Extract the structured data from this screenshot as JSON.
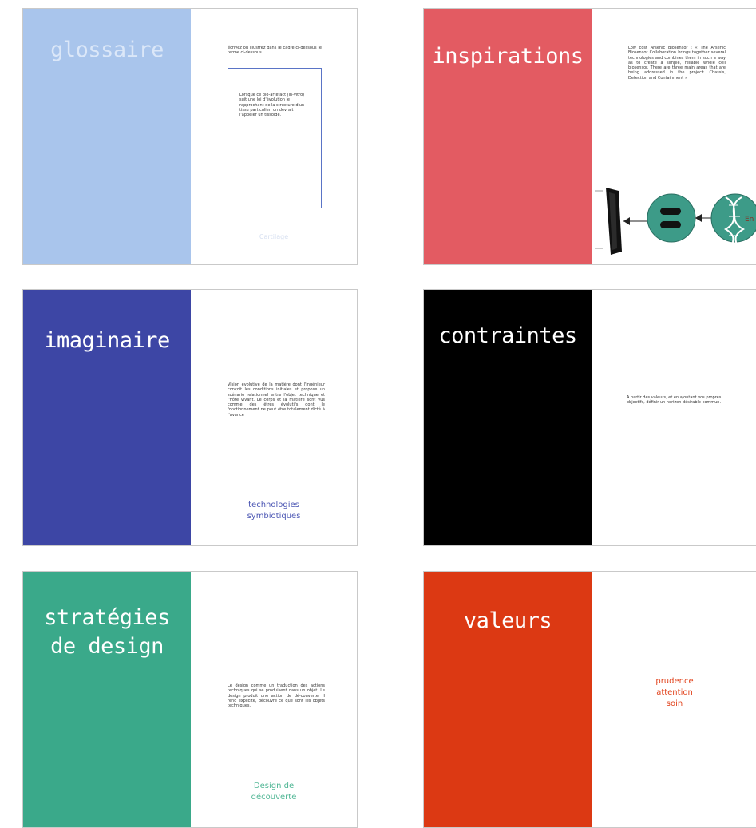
{
  "cards": [
    {
      "id": "glossaire",
      "color": "#a9c5ec",
      "title": "glossaire",
      "title_color": "#dbe7f8",
      "top_text": "écrivez ou illustrez dans le cadre ci-dessous le terme ci-dessous.",
      "box_text": "Lorsque ce bio-artefact (in-vitro) suit une loi d'évolution le rapprochant de la structure d'un tissu particulier, on devrait l'appeler un tissoïde.",
      "caption": "Cartilage",
      "caption_color": "#dfe6f3"
    },
    {
      "id": "inspirations",
      "color": "#e35b62",
      "title": "inspirations",
      "title_color": "#ffffff",
      "body": "Low cost Arsenic Biosensor : « The Arsenic Biosensor Collaboration brings together several technologies and combines them in such a way as to create a simple, reliable whole cell biosensor. There are three main areas that are being addressed in the project: Chassis, Detection and Containment »",
      "illustration_label": "En"
    },
    {
      "id": "imaginaire",
      "color": "#3d46a5",
      "title": "imaginaire",
      "title_color": "#ffffff",
      "body": "Vision évolutive de la matière dont l'ingénieur conçoit les conditions initiales et propose un scénario relationnel entre l'objet technique et l'hôte vivant. Le corps et la matière sont vus comme des êtres évolutifs dont le fonctionnement ne peut être totalement dicté à l'avance",
      "caption": [
        "technologies",
        "symbiotiques"
      ],
      "caption_color": "#4a55b3"
    },
    {
      "id": "contraintes",
      "color": "#000000",
      "title": "contraintes",
      "title_color": "#ffffff",
      "body": "A partir des valeurs, et en ajoutant vos propres objectifs, définir un horizon désirable commun."
    },
    {
      "id": "strategies",
      "color": "#3aa98a",
      "title": [
        "stratégies",
        "de design"
      ],
      "title_color": "#ffffff",
      "body": "Le design comme un traduction des actions techniques qui se produisent dans un objet. Le design produit une action de dé-couverte. Il rend explicite, découvre ce que sont les objets techniques.",
      "caption": [
        "Design de",
        "découverte"
      ],
      "caption_color": "#4fb694"
    },
    {
      "id": "valeurs",
      "color": "#dc3913",
      "title": "valeurs",
      "title_color": "#ffffff",
      "caption": [
        "prudence",
        "attention",
        "soin"
      ],
      "caption_color": "#e2451f"
    }
  ]
}
